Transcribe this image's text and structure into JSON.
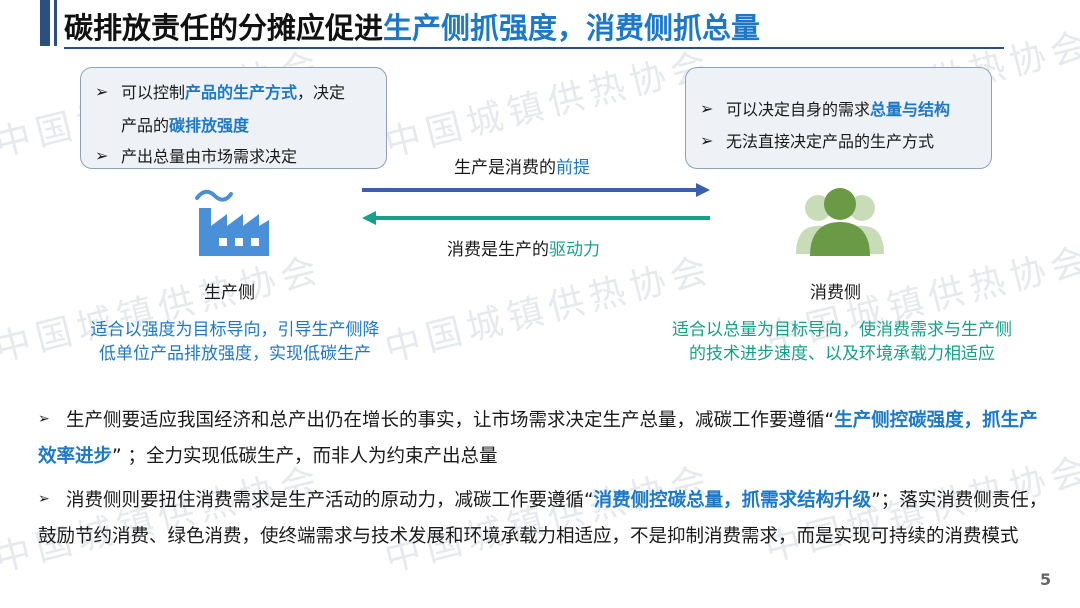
{
  "header": {
    "title_black": "碳排放责任的分摊应促进",
    "title_blue": "生产侧抓强度，消费侧抓总量"
  },
  "watermark": "中国城镇供热协会",
  "producer_box": {
    "line1_pre": "可以控制",
    "line1_hl": "产品的生产方式",
    "line1_post": "，决定",
    "line2_pre": "产品的",
    "line2_hl": "碳排放强度",
    "line3": "产出总量由市场需求决定"
  },
  "consumer_box": {
    "line1_pre": "可以决定自身的需求",
    "line1_hl": "总量与结构",
    "line2": "无法直接决定产品的生产方式"
  },
  "arrows": {
    "top_pre": "生产是消费的",
    "top_hl": "前提",
    "bottom_pre": "消费是生产的",
    "bottom_hl": "驱动力"
  },
  "producer_label": "生产侧",
  "consumer_label": "消费侧",
  "producer_text": {
    "line1": "适合以强度为目标导向，引导生产侧降",
    "line2": "低单位产品排放强度，实现低碳生产"
  },
  "consumer_text": {
    "line1": "适合以总量为目标导向，使消费需求与生产侧",
    "line2": "的技术进步速度、以及环境承载力相适应"
  },
  "paragraphs": {
    "p1_a": "生产侧要适应我国经济和总产出仍在增长的事实，让市场需求决定生产总量，减碳工作要遵循“",
    "p1_hl": "生产侧控碳强度，抓生产效率进步",
    "p1_b": "” ；全力实现低碳生产，而非人为约束产出总量",
    "p2_a": "消费侧则要扭住消费需求是生产活动的原动力，减碳工作要遵循“",
    "p2_hl": "消费侧控碳总量，抓需求结构升级",
    "p2_b": "”；落实消费侧责任，鼓励节约消费、绿色消费，使终端需求与技术发展和环境承载力相适应，不是抑制消费需求，而是实现可持续的消费模式"
  },
  "page_number": "5",
  "bullet_glyph": "➢",
  "colors": {
    "accent_blue": "#1d79c8",
    "teal": "#17a089",
    "navy": "#2b4f7e"
  },
  "icons": [
    "factory-icon",
    "person-icon"
  ]
}
